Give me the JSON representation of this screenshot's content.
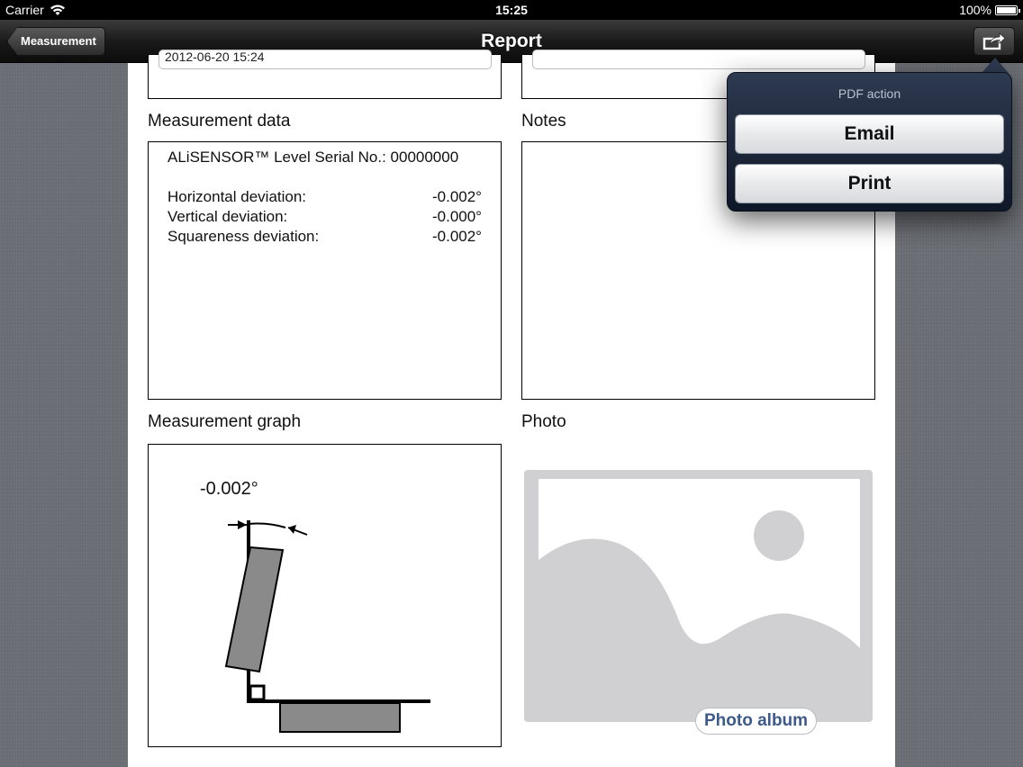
{
  "status_bar": {
    "carrier": "Carrier",
    "time": "15:25",
    "battery": "100%"
  },
  "nav": {
    "back_label": "Measurement",
    "title": "Report"
  },
  "report": {
    "date_partial": "2012-06-20 15:24",
    "measurement_data": {
      "label": "Measurement data",
      "serial_line": "ALiSENSOR™ Level Serial No.: 00000000",
      "rows": [
        {
          "name": "Horizontal deviation:",
          "value": "-0.002°"
        },
        {
          "name": "Vertical deviation:",
          "value": "-0.000°"
        },
        {
          "name": "Squareness deviation:",
          "value": "-0.002°"
        }
      ]
    },
    "notes": {
      "label": "Notes"
    },
    "graph": {
      "label": "Measurement graph",
      "angle": "-0.002°"
    },
    "photo": {
      "label": "Photo",
      "album_button": "Photo album"
    }
  },
  "popover": {
    "title": "PDF action",
    "buttons": [
      "Email",
      "Print"
    ]
  },
  "colors": {
    "popover_bg": "#1a2438",
    "accent_link": "#3d5a8a",
    "placeholder_gray": "#d0d0d2"
  }
}
